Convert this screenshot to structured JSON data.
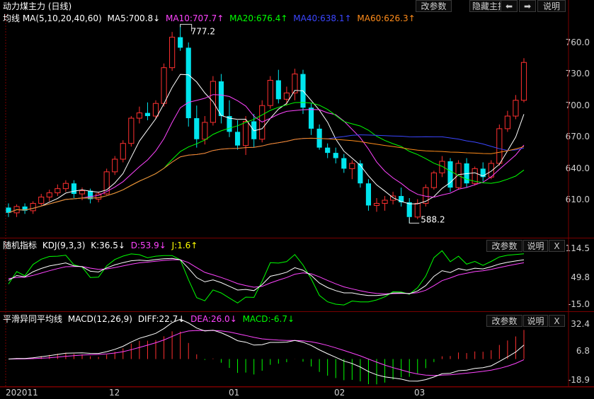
{
  "top_buttons": {
    "modify": "改参数",
    "hide": "隐藏主指标",
    "prev": "⬅",
    "next": "➡",
    "help": "说明"
  },
  "main": {
    "title": "动力煤主力 (日线)",
    "ma_label": "均线 MA(5,10,20,40,60)",
    "ma5": "MA5:700.8↓",
    "ma10": "MA10:707.7↑",
    "ma20": "MA20:676.4↑",
    "ma40": "MA40:638.1↑",
    "ma60": "MA60:626.3↑",
    "high_label": "777.2",
    "low_label": "588.2",
    "yticks": [
      "760.0",
      "730.0",
      "700.0",
      "670.0",
      "640.0",
      "610.0"
    ]
  },
  "kdj": {
    "title": "随机指标",
    "params": "KDJ(9,3,3)",
    "k": "K:36.5↓",
    "d": "D:53.9↓",
    "j": "J:1.6↑",
    "modify": "改参数",
    "help": "说明",
    "close": "X",
    "yticks": [
      "114.5",
      "49.8",
      "-15.0"
    ]
  },
  "macd": {
    "title": "平滑异同平均线",
    "params": "MACD(12,26,9)",
    "diff": "DIFF:22.7↓",
    "dea": "DEA:26.0↓",
    "macd": "MACD:-6.7↓",
    "modify": "改参数",
    "help": "说明",
    "close": "X",
    "yticks": [
      "32.4",
      "6.8",
      "-18.9"
    ]
  },
  "xaxis": {
    "labels": [
      "202011",
      "12",
      "01",
      "02",
      "03"
    ]
  },
  "colors": {
    "up": "#ff3030",
    "down": "#00e5ee",
    "ma5": "#ffffff",
    "ma10": "#ff44ff",
    "ma20": "#00ff00",
    "ma40": "#3b46ff",
    "ma60": "#ff8c1a"
  },
  "chart_data": {
    "type": "candlestick",
    "title": "动力煤主力 (日线)",
    "ylim": [
      585,
      785
    ],
    "series": [
      {
        "name": "K",
        "type": "candlestick",
        "ohlc": [
          [
            603,
            607,
            594,
            598
          ],
          [
            598,
            606,
            594,
            604
          ],
          [
            604,
            607,
            597,
            600
          ],
          [
            600,
            609,
            597,
            607
          ],
          [
            607,
            616,
            605,
            613
          ],
          [
            613,
            620,
            609,
            617
          ],
          [
            617,
            625,
            614,
            621
          ],
          [
            621,
            629,
            618,
            626
          ],
          [
            626,
            629,
            612,
            616
          ],
          [
            616,
            622,
            610,
            619
          ],
          [
            619,
            621,
            607,
            611
          ],
          [
            611,
            618,
            608,
            616
          ],
          [
            616,
            640,
            615,
            637
          ],
          [
            637,
            652,
            634,
            649
          ],
          [
            649,
            667,
            646,
            664
          ],
          [
            664,
            690,
            661,
            688
          ],
          [
            688,
            699,
            683,
            693
          ],
          [
            693,
            703,
            686,
            690
          ],
          [
            690,
            705,
            687,
            702
          ],
          [
            702,
            740,
            699,
            736
          ],
          [
            736,
            770,
            733,
            765
          ],
          [
            765,
            777.2,
            752,
            755
          ],
          [
            755,
            760,
            680,
            688
          ],
          [
            688,
            700,
            660,
            668
          ],
          [
            668,
            690,
            663,
            684
          ],
          [
            684,
            728,
            681,
            723
          ],
          [
            723,
            730,
            683,
            690
          ],
          [
            690,
            705,
            670,
            675
          ],
          [
            675,
            686,
            658,
            662
          ],
          [
            662,
            690,
            653,
            685
          ],
          [
            685,
            692,
            660,
            668
          ],
          [
            668,
            705,
            665,
            700
          ],
          [
            700,
            728,
            697,
            724
          ],
          [
            724,
            734,
            702,
            706
          ],
          [
            706,
            718,
            700,
            712
          ],
          [
            712,
            735,
            705,
            730
          ],
          [
            730,
            734,
            692,
            698
          ],
          [
            698,
            702,
            672,
            678
          ],
          [
            678,
            682,
            658,
            660
          ],
          [
            660,
            664,
            650,
            655
          ],
          [
            655,
            660,
            645,
            650
          ],
          [
            650,
            654,
            636,
            640
          ],
          [
            640,
            648,
            630,
            645
          ],
          [
            645,
            648,
            622,
            626
          ],
          [
            626,
            630,
            600,
            605
          ],
          [
            605,
            612,
            599,
            607
          ],
          [
            607,
            614,
            600,
            610
          ],
          [
            610,
            618,
            606,
            614
          ],
          [
            614,
            622,
            604,
            608
          ],
          [
            608,
            612,
            588.2,
            594
          ],
          [
            594,
            611,
            592,
            607
          ],
          [
            607,
            625,
            604,
            622
          ],
          [
            622,
            638,
            620,
            636
          ],
          [
            636,
            652,
            632,
            647
          ],
          [
            647,
            650,
            618,
            622
          ],
          [
            622,
            648,
            620,
            645
          ],
          [
            645,
            650,
            622,
            626
          ],
          [
            626,
            642,
            624,
            640
          ],
          [
            640,
            646,
            628,
            632
          ],
          [
            632,
            648,
            630,
            645
          ],
          [
            645,
            682,
            643,
            678
          ],
          [
            678,
            695,
            675,
            690
          ],
          [
            690,
            710,
            687,
            705
          ],
          [
            705,
            745,
            703,
            741
          ]
        ]
      },
      {
        "name": "MA5"
      },
      {
        "name": "MA10"
      },
      {
        "name": "MA20"
      },
      {
        "name": "MA40"
      },
      {
        "name": "MA60"
      }
    ]
  }
}
